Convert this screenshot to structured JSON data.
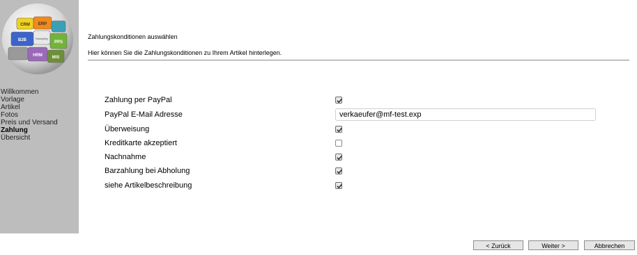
{
  "sidebar": {
    "logo_pieces": [
      "CRM",
      "ERP",
      "B2B",
      "FactoryKey",
      "PPS",
      "HRM",
      "MIS"
    ],
    "nav": [
      {
        "label": "Willkommen",
        "active": false
      },
      {
        "label": "Vorlage",
        "active": false
      },
      {
        "label": "Artikel",
        "active": false
      },
      {
        "label": "Fotos",
        "active": false
      },
      {
        "label": "Preis und Versand",
        "active": false
      },
      {
        "label": "Zahlung",
        "active": true
      },
      {
        "label": "Übersicht",
        "active": false
      }
    ]
  },
  "header": {
    "title": "Zahlungskonditionen auswählen",
    "description": "Hier können Sie die Zahlungskonditionen zu Ihrem Artikel hinterlegen."
  },
  "form": {
    "paypal": {
      "label": "Zahlung per PayPal",
      "checked": true
    },
    "paypal_email": {
      "label": "PayPal E-Mail Adresse",
      "value": "verkaeufer@mf-test.exp"
    },
    "ueberweisung": {
      "label": "Überweisung",
      "checked": true
    },
    "kreditkarte": {
      "label": "Kreditkarte akzeptiert",
      "checked": false
    },
    "nachnahme": {
      "label": "Nachnahme",
      "checked": true
    },
    "barzahlung": {
      "label": "Barzahlung bei Abholung",
      "checked": true
    },
    "siehe": {
      "label": "siehe Artikelbeschreibung",
      "checked": true
    }
  },
  "buttons": {
    "back": "< Zurück",
    "next": "Weiter >",
    "cancel": "Abbrechen"
  },
  "colors": {
    "sidebar_bg": "#bdbdbd",
    "logo_crm": "#f2d21c",
    "logo_erp": "#f08a1c",
    "logo_b2b": "#3c63c9",
    "logo_pps": "#72b43a",
    "logo_hrm": "#9a6ab8",
    "logo_mis": "#6e8f3a"
  }
}
